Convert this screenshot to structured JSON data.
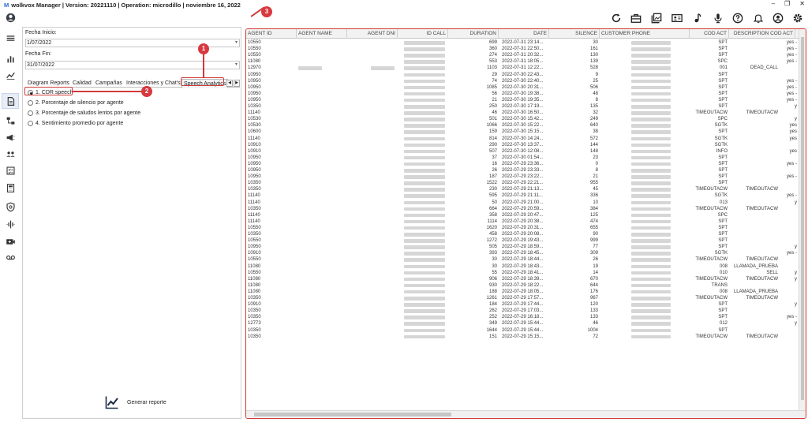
{
  "window": {
    "logo": "M",
    "title": "wolkvox Manager  | Version: 20221110  |  Operation: microdillo  | noviembre 16, 2022",
    "minimize": "–",
    "restore": "❐",
    "close": "✕"
  },
  "form": {
    "fecha_inicio_label": "Fecha Inicio:",
    "fecha_inicio_value": "1/07/2022",
    "fecha_fin_label": "Fecha Fin:",
    "fecha_fin_value": "31/07/2022"
  },
  "tabs": [
    "Diagram Reports",
    "Calidad",
    "Campañas",
    "Interacciones y Chat's",
    "Speech Analytics"
  ],
  "tab_prev": "◀",
  "tab_next": "▶",
  "reports": [
    {
      "label": "1. CDR speech",
      "selected": true
    },
    {
      "label": "2. Porcentaje de silencio por agente",
      "selected": false
    },
    {
      "label": "3. Porcentaje de saludos lentos por agente",
      "selected": false
    },
    {
      "label": "4. Sentimiento promedio por agente",
      "selected": false
    }
  ],
  "generate_button": "Generar reporte",
  "badges": [
    "1",
    "2",
    "3"
  ],
  "grid": {
    "columns": [
      "AGENT ID",
      "AGENT NAME",
      "AGENT DNI",
      "ID CALL",
      "DURATION",
      "DATE",
      "SILENCE",
      "CUSTOMER PHONE",
      "COD ACT",
      "DESCRIPTION COD ACT"
    ],
    "rows": [
      [
        "10550",
        "",
        "",
        "",
        "699",
        "2022-07-31 23:14...",
        "30",
        "",
        "SPT",
        "",
        "yes -"
      ],
      [
        "10550",
        "",
        "",
        "",
        "360",
        "2022-07-31 22:50...",
        "161",
        "",
        "SPT",
        "",
        "yes -"
      ],
      [
        "10550",
        "",
        "",
        "",
        "274",
        "2022-07-31 20:32...",
        "130",
        "",
        "SPT",
        "",
        "yes -"
      ],
      [
        "11080",
        "",
        "",
        "",
        "553",
        "2022-07-31 18:05...",
        "139",
        "",
        "SPC",
        "",
        "yes -"
      ],
      [
        "12970",
        "",
        "",
        "",
        "1103",
        "2022-07-31 12:22...",
        "528",
        "",
        "001",
        "DEAD_CALL",
        ""
      ],
      [
        "10950",
        "",
        "",
        "",
        "29",
        "2022-07-30 22:43...",
        "9",
        "",
        "SPT",
        "",
        ""
      ],
      [
        "10950",
        "",
        "",
        "",
        "74",
        "2022-07-30 22:40...",
        "25",
        "",
        "SPT",
        "",
        "yes -"
      ],
      [
        "10950",
        "",
        "",
        "",
        "1085",
        "2022-07-30 20:31...",
        "506",
        "",
        "SPT",
        "",
        "yes -"
      ],
      [
        "10950",
        "",
        "",
        "",
        "56",
        "2022-07-30 19:38...",
        "48",
        "",
        "SPT",
        "",
        "yes -"
      ],
      [
        "10950",
        "",
        "",
        "",
        "21",
        "2022-07-30 19:35...",
        "8",
        "",
        "SPT",
        "",
        "yes -"
      ],
      [
        "10350",
        "",
        "",
        "",
        "250",
        "2022-07-30 17:19...",
        "135",
        "",
        "SPT",
        "",
        "y"
      ],
      [
        "11140",
        "",
        "",
        "",
        "46",
        "2022-07-30 16:50...",
        "32",
        "",
        "TIMEOUTACW",
        "TIMEOUTACW",
        ""
      ],
      [
        "10530",
        "",
        "",
        "",
        "501",
        "2022-07-30 15:42...",
        "249",
        "",
        "SPC",
        "",
        "y"
      ],
      [
        "10530",
        "",
        "",
        "",
        "1066",
        "2022-07-30 15:22...",
        "640",
        "",
        "SGTK",
        "",
        "yes"
      ],
      [
        "10600",
        "",
        "",
        "",
        "159",
        "2022-07-30 15:15...",
        "38",
        "",
        "SPT",
        "",
        "yes"
      ],
      [
        "11140",
        "",
        "",
        "",
        "814",
        "2022-07-30 14:24...",
        "572",
        "",
        "SGTK",
        "",
        "yes"
      ],
      [
        "10910",
        "",
        "",
        "",
        "290",
        "2022-07-30 13:37...",
        "144",
        "",
        "SGTK",
        "",
        ""
      ],
      [
        "10910",
        "",
        "",
        "",
        "507",
        "2022-07-30 12:08...",
        "148",
        "",
        "INFO",
        "",
        "yes"
      ],
      [
        "10950",
        "",
        "",
        "",
        "37",
        "2022-07-30 01:54...",
        "23",
        "",
        "SPT",
        "",
        ""
      ],
      [
        "10950",
        "",
        "",
        "",
        "16",
        "2022-07-29 23:36...",
        "0",
        "",
        "SPT",
        "",
        "yes -"
      ],
      [
        "10950",
        "",
        "",
        "",
        "26",
        "2022-07-29 23:33...",
        "8",
        "",
        "SPT",
        "",
        ""
      ],
      [
        "10950",
        "",
        "",
        "",
        "187",
        "2022-07-29 23:22...",
        "21",
        "",
        "SPT",
        "",
        "yes -"
      ],
      [
        "10350",
        "",
        "",
        "",
        "1522",
        "2022-07-29 22:21...",
        "955",
        "",
        "SPT",
        "",
        ""
      ],
      [
        "10350",
        "",
        "",
        "",
        "230",
        "2022-07-29 21:13...",
        "45",
        "",
        "TIMEOUTACW",
        "TIMEOUTACW",
        ""
      ],
      [
        "11140",
        "",
        "",
        "",
        "595",
        "2022-07-29 21:11...",
        "336",
        "",
        "SGTK",
        "",
        "yes -"
      ],
      [
        "11140",
        "",
        "",
        "",
        "50",
        "2022-07-29 21:00...",
        "10",
        "",
        "013",
        "",
        "y"
      ],
      [
        "10350",
        "",
        "",
        "",
        "664",
        "2022-07-29 20:59...",
        "384",
        "",
        "TIMEOUTACW",
        "TIMEOUTACW",
        ""
      ],
      [
        "11140",
        "",
        "",
        "",
        "358",
        "2022-07-29 20:47...",
        "125",
        "",
        "SPC",
        "",
        ""
      ],
      [
        "11140",
        "",
        "",
        "",
        "1114",
        "2022-07-29 20:38...",
        "474",
        "",
        "SPT",
        "",
        ""
      ],
      [
        "10550",
        "",
        "",
        "",
        "1620",
        "2022-07-29 20:31...",
        "655",
        "",
        "SPT",
        "",
        ""
      ],
      [
        "10350",
        "",
        "",
        "",
        "458",
        "2022-07-29 20:08...",
        "90",
        "",
        "SPT",
        "",
        ""
      ],
      [
        "10550",
        "",
        "",
        "",
        "1272",
        "2022-07-29 19:43...",
        "999",
        "",
        "SPT",
        "",
        ""
      ],
      [
        "10950",
        "",
        "",
        "",
        "505",
        "2022-07-29 18:59...",
        "77",
        "",
        "SPT",
        "",
        "y"
      ],
      [
        "10910",
        "",
        "",
        "",
        "393",
        "2022-07-29 18:45...",
        "309",
        "",
        "SGTK",
        "",
        "yes -"
      ],
      [
        "10550",
        "",
        "",
        "",
        "30",
        "2022-07-29 18:44...",
        "26",
        "",
        "TIMEOUTACW",
        "TIMEOUTACW",
        ""
      ],
      [
        "11080",
        "",
        "",
        "",
        "30",
        "2022-07-29 18:43...",
        "19",
        "",
        "008",
        "LLAMADA_PRUEBA",
        ""
      ],
      [
        "10550",
        "",
        "",
        "",
        "55",
        "2022-07-29 18:41...",
        "14",
        "",
        "010",
        "SELL",
        "y"
      ],
      [
        "11080",
        "",
        "",
        "",
        "906",
        "2022-07-29 18:39...",
        "670",
        "",
        "TIMEOUTACW",
        "TIMEOUTACW",
        "y"
      ],
      [
        "11080",
        "",
        "",
        "",
        "930",
        "2022-07-29 18:22...",
        "644",
        "",
        "TRANS",
        "",
        ""
      ],
      [
        "11080",
        "",
        "",
        "",
        "188",
        "2022-07-29 18:05...",
        "176",
        "",
        "008",
        "LLAMADA_PRUEBA",
        ""
      ],
      [
        "10350",
        "",
        "",
        "",
        "1261",
        "2022-07-29 17:57...",
        "967",
        "",
        "TIMEOUTACW",
        "TIMEOUTACW",
        ""
      ],
      [
        "10910",
        "",
        "",
        "",
        "184",
        "2022-07-29 17:44...",
        "120",
        "",
        "SPT",
        "",
        "y"
      ],
      [
        "10350",
        "",
        "",
        "",
        "262",
        "2022-07-29 17:03...",
        "133",
        "",
        "SPT",
        "",
        ""
      ],
      [
        "10350",
        "",
        "",
        "",
        "252",
        "2022-07-29 16:18...",
        "133",
        "",
        "SPT",
        "",
        "yes -"
      ],
      [
        "12773",
        "",
        "",
        "",
        "349",
        "2022-07-29 15:44...",
        "46",
        "",
        "012",
        "",
        "y"
      ],
      [
        "10350",
        "",
        "",
        "",
        "1644",
        "2022-07-29 15:44...",
        "1004",
        "",
        "SPT",
        "",
        ""
      ],
      [
        "10350",
        "",
        "",
        "",
        "151",
        "2022-07-29 15:15...",
        "72",
        "",
        "TIMEOUTACW",
        "TIMEOUTACW",
        ""
      ]
    ]
  },
  "colors": {
    "accent_red": "#d23a3a",
    "badge_red": "#d8383f",
    "logo_blue": "#2a6ad6"
  },
  "icons": {
    "sidebar": [
      "user-circle-icon",
      "menu-icon",
      "bar-chart-icon",
      "trend-icon",
      "document-icon",
      "flow-icon",
      "megaphone-icon",
      "team-icon",
      "checklist-icon",
      "calculator-icon",
      "shield-icon",
      "audio-wave-icon",
      "video-add-icon",
      "voicemail-icon"
    ],
    "toolbar": [
      "refresh-icon",
      "briefcase-icon",
      "gallery-icon",
      "id-card-icon",
      "music-note-icon",
      "microphone-icon",
      "help-icon",
      "bell-icon",
      "account-icon",
      "settings-icon"
    ]
  }
}
